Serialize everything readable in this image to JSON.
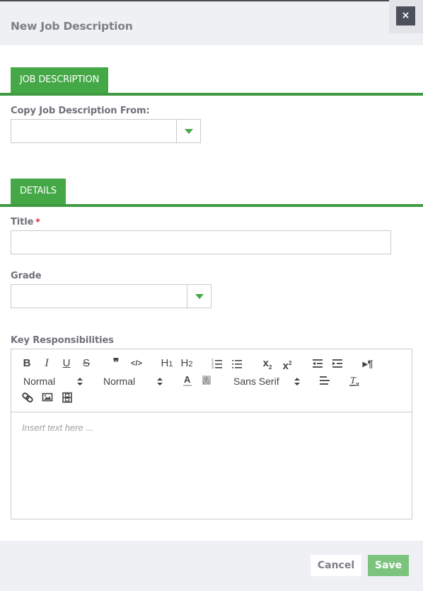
{
  "dialog": {
    "title": "New Job Description",
    "close_label": "×"
  },
  "sections": {
    "job_description": {
      "tab_label": "JOB DESCRIPTION",
      "copy_from_label": "Copy Job Description From:",
      "copy_from_value": ""
    },
    "details": {
      "tab_label": "DETAILS",
      "title_label": "Title",
      "title_required_marker": "*",
      "title_value": "",
      "grade_label": "Grade",
      "grade_value": "",
      "key_responsibilities_label": "Key Responsibilities"
    }
  },
  "editor": {
    "placeholder": "Insert text here ...",
    "toolbar": {
      "bold": "B",
      "italic": "I",
      "underline": "U",
      "strike": "S",
      "blockquote": "❞",
      "code": "</>",
      "h1": "H",
      "h1_sub": "1",
      "h2": "H",
      "h2_sub": "2",
      "subscript": "x",
      "subscript_sub": "2",
      "superscript": "x",
      "superscript_sup": "2",
      "rtl": "▸¶",
      "header_picker": "Normal",
      "size_picker": "Normal",
      "font_picker": "Sans Serif",
      "chevron": "⬍"
    }
  },
  "footer": {
    "cancel_label": "Cancel",
    "save_label": "Save"
  },
  "colors": {
    "accent": "#44a846",
    "accent_dark": "#3f9a41",
    "save_button": "#7cc47e",
    "close_button": "#4b505b",
    "required": "#e02020"
  }
}
